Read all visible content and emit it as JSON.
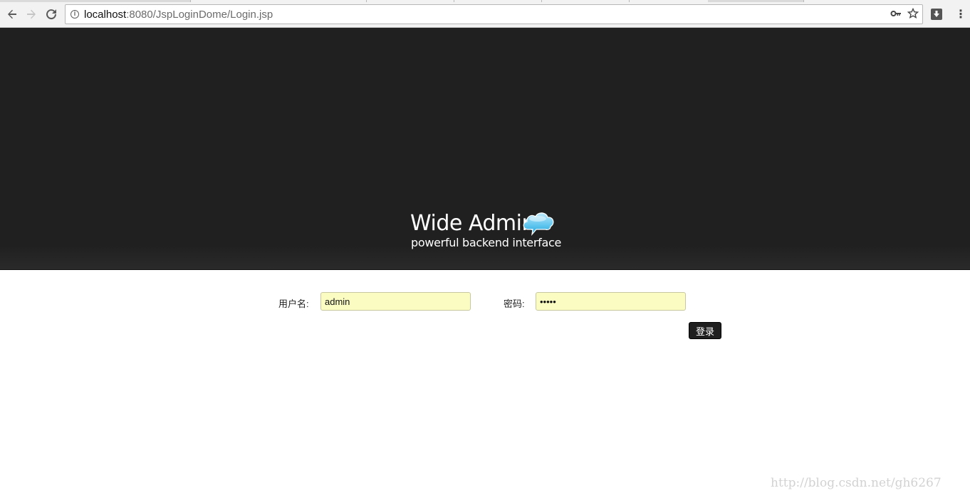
{
  "browser": {
    "url_host": "localhost",
    "url_rest": ":8080/JspLoginDome/Login.jsp",
    "icons": {
      "back": "back-arrow-icon",
      "forward": "forward-arrow-icon",
      "reload": "reload-icon",
      "info": "info-icon",
      "key": "key-icon",
      "star": "star-icon",
      "extension": "extension-icon",
      "menu": "menu-icon"
    }
  },
  "banner": {
    "logo_title": "Wide Admin",
    "logo_subtitle": "powerful backend interface"
  },
  "form": {
    "username_label": "用户名:",
    "username_value": "admin",
    "password_label": "密码:",
    "password_value": "admin",
    "submit_label": "登录"
  },
  "watermark": "http://blog.csdn.net/gh6267",
  "colors": {
    "banner_bg": "#202020",
    "input_bg": "#fafcc2",
    "button_bg": "#1f1f1f"
  }
}
